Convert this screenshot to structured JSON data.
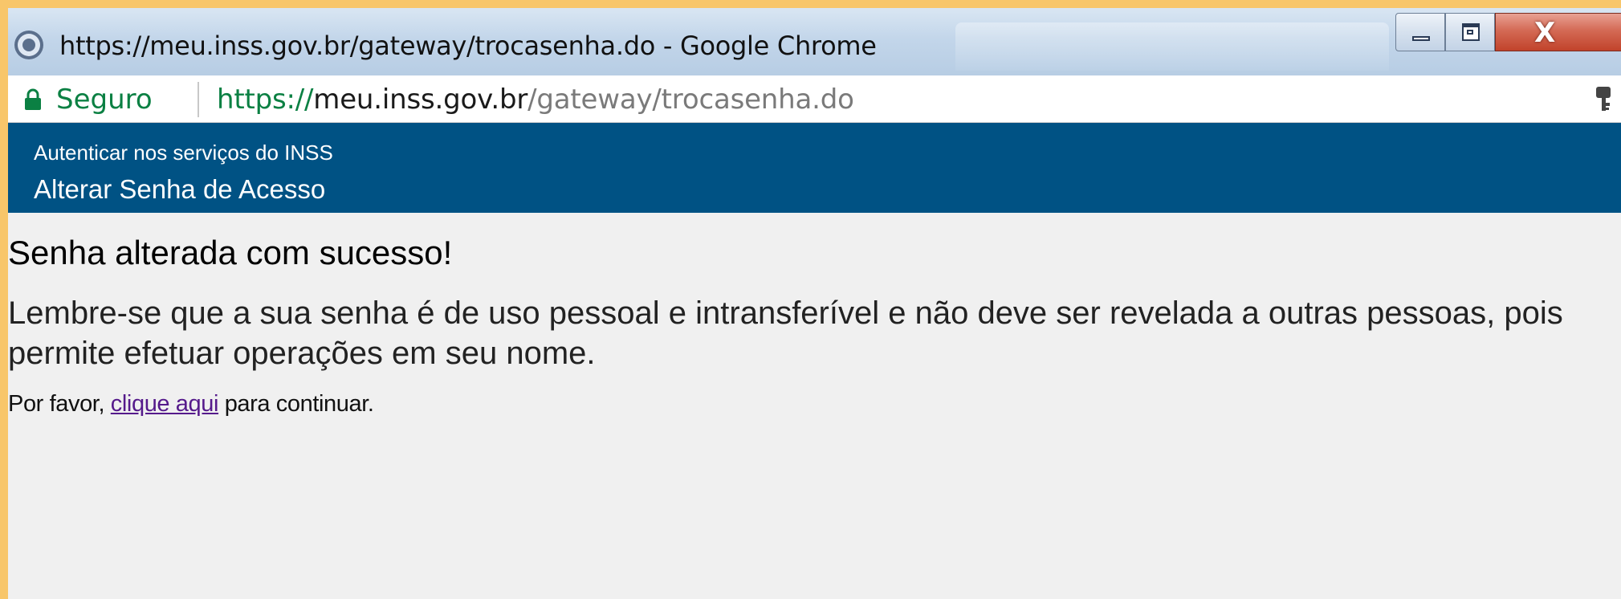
{
  "browser": {
    "window_title": "https://meu.inss.gov.br/gateway/trocasenha.do - Google Chrome",
    "secure_label": "Seguro",
    "url": {
      "scheme": "https://",
      "host": "meu.inss.gov.br",
      "path": "/gateway/trocasenha.do"
    },
    "window_controls": [
      "minimize",
      "maximize",
      "close"
    ],
    "close_glyph": "X"
  },
  "header": {
    "subtitle": "Autenticar nos serviços do INSS",
    "title": "Alterar Senha de Acesso",
    "background_color": "#005284"
  },
  "main": {
    "success_heading": "Senha alterada com sucesso!",
    "reminder": "Lembre-se que a sua senha é de uso pessoal e intransferível e não deve ser revelada a outras pessoas, pois permite efetuar operações em seu nome.",
    "continue_prefix": "Por favor, ",
    "continue_link": "clique aqui",
    "continue_suffix": " para continuar."
  },
  "colors": {
    "secure_green": "#0b8043",
    "link_visited": "#551a8b"
  }
}
